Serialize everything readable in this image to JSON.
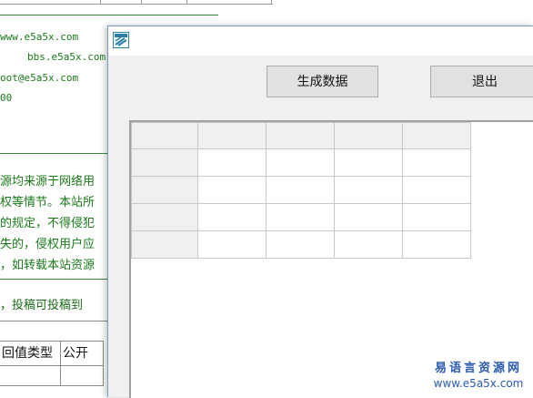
{
  "background_page": {
    "contact_lines": [
      "www.e5a5x.com",
      "bbs.e5a5x.com",
      "oot@e5a5x.com",
      "00"
    ],
    "notice_lines": [
      "源均来源于网络用",
      "权等情节。本站所",
      "的规定，不得侵犯",
      "失的，侵权用户应",
      "，如转载本站资源"
    ],
    "submit_line": "，投稿可投稿到",
    "table_headers": [
      "回值类型",
      "公开"
    ]
  },
  "window": {
    "title": "",
    "icon": "app-icon",
    "buttons": {
      "generate_label": "生成数据",
      "exit_label": "退出"
    },
    "grid": {
      "columns": 5,
      "rows": 5,
      "cells": [
        [
          "",
          "",
          "",
          "",
          ""
        ],
        [
          "",
          "",
          "",
          "",
          ""
        ],
        [
          "",
          "",
          "",
          "",
          ""
        ],
        [
          "",
          "",
          "",
          "",
          ""
        ],
        [
          "",
          "",
          "",
          "",
          ""
        ]
      ]
    }
  },
  "watermark": {
    "name": "易语言资源网",
    "url": "www.e5a5x.com"
  }
}
